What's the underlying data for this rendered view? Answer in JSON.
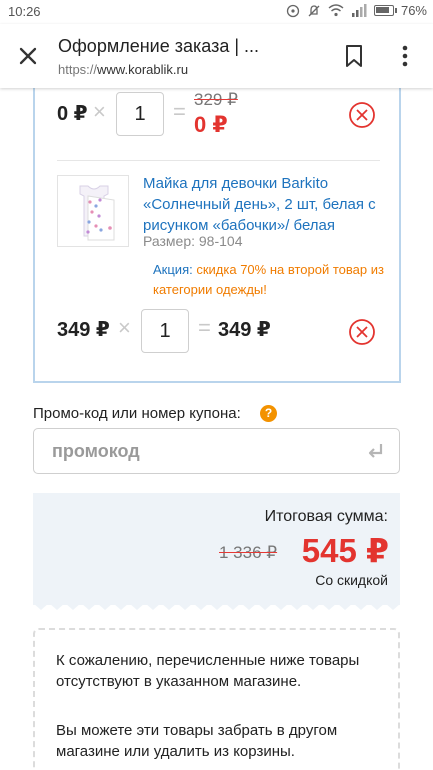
{
  "status_bar": {
    "time": "10:26",
    "battery": "76%"
  },
  "browser": {
    "title": "Оформление заказа | ...",
    "url_scheme": "https://",
    "url_host": "www.korablik.ru"
  },
  "cart": {
    "items": [
      {
        "unit_price": "0 ₽",
        "quantity": "1",
        "old_total": "329 ₽",
        "total": "0 ₽"
      },
      {
        "name": "Майка для девочки Barkito «Солнечный день», 2 шт, белая с рисунком «бабочки»/ белая",
        "size": "Размер: 98-104",
        "promo_label": "Акция:",
        "promo_text": "скидка 70% на второй товар из категории одежды!",
        "unit_price": "349 ₽",
        "quantity": "1",
        "total": "349 ₽"
      }
    ]
  },
  "promo": {
    "label": "Промо-код или номер купона:",
    "help": "?",
    "placeholder": "промокод"
  },
  "summary": {
    "label": "Итоговая сумма:",
    "old_total": "1 336 ₽",
    "total": "545 ₽",
    "note": "Со скидкой"
  },
  "notice": {
    "text1": "К сожалению, перечисленные ниже товары отсутствуют в указанном магазине.",
    "text2": "Вы можете эти товары забрать в другом магазине или удалить из корзины."
  },
  "colors": {
    "accent_red": "#e3342f",
    "link_blue": "#1e73be",
    "promo_orange": "#f07c00",
    "panel_border": "#b9d4ec"
  }
}
